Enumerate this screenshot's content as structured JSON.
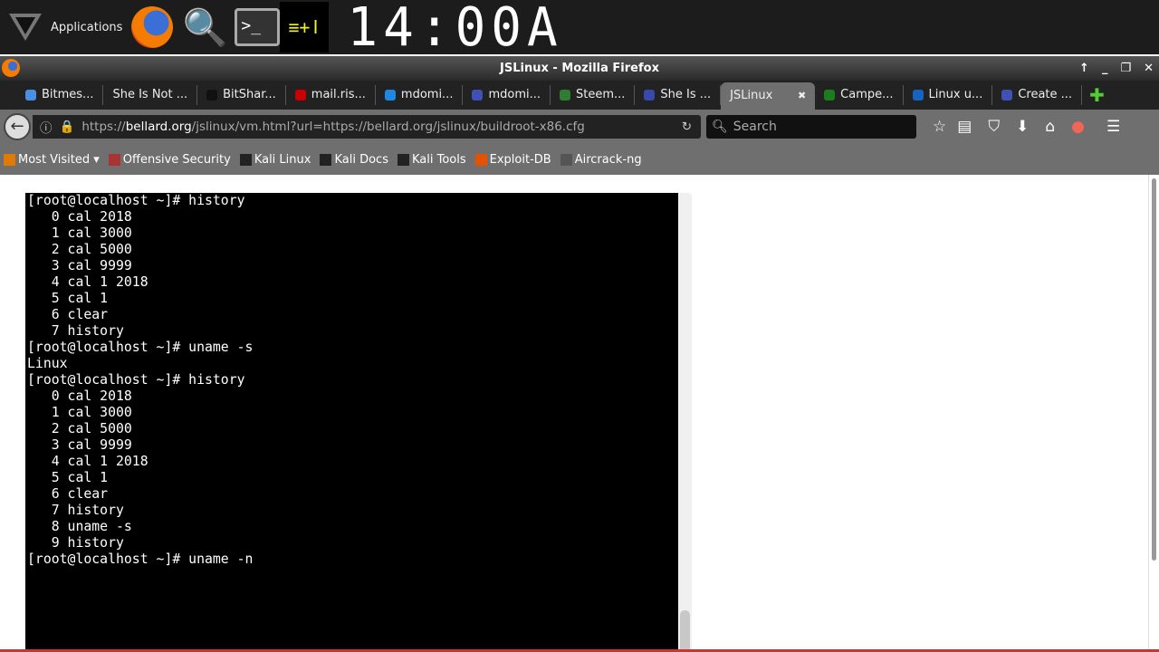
{
  "panel": {
    "applications_label": "Applications",
    "clock": "14:00A",
    "monitor_glyph": "≡+ǀ"
  },
  "window": {
    "title": "JSLinux - Mozilla Firefox",
    "controls": [
      "↑",
      "_",
      "❐",
      "✕"
    ]
  },
  "tabs": [
    {
      "label": "Bitmes...",
      "color": "#4a90e2"
    },
    {
      "label": "She Is Not ...",
      "color": ""
    },
    {
      "label": "BitShar...",
      "color": "#111"
    },
    {
      "label": "mail.ris...",
      "color": "#c00"
    },
    {
      "label": "mdomi...",
      "color": "#1e88e5"
    },
    {
      "label": "mdomi...",
      "color": "#3f51b5"
    },
    {
      "label": "Steem...",
      "color": "#2e7d32"
    },
    {
      "label": "She Is ...",
      "color": "#3949ab"
    },
    {
      "label": "JSLinux",
      "active": true,
      "close": "✖"
    },
    {
      "label": "Campe...",
      "color": "#1b7d1b"
    },
    {
      "label": "Linux u...",
      "color": "#1565c0"
    },
    {
      "label": "Create ...",
      "color": "#3f51b5"
    }
  ],
  "nav": {
    "url_prefix": "https://",
    "url_domain": "bellard.org",
    "url_rest": "/jslinux/vm.html?url=https://bellard.org/jslinux/buildroot-x86.cfg",
    "search_placeholder": "Search"
  },
  "bookmarks": [
    {
      "label": "Most Visited ▾",
      "color": "#e07b00"
    },
    {
      "label": "Offensive Security",
      "color": "#a33"
    },
    {
      "label": "Kali Linux",
      "color": "#222"
    },
    {
      "label": "Kali Docs",
      "color": "#222"
    },
    {
      "label": "Kali Tools",
      "color": "#222"
    },
    {
      "label": "Exploit-DB",
      "color": "#e65100"
    },
    {
      "label": "Aircrack-ng",
      "color": "#555"
    }
  ],
  "terminal": {
    "lines": [
      "[root@localhost ~]# history",
      "   0 cal 2018",
      "   1 cal 3000",
      "   2 cal 5000",
      "   3 cal 9999",
      "   4 cal 1 2018",
      "   5 cal 1",
      "   6 clear",
      "   7 history",
      "[root@localhost ~]# uname -s",
      "Linux",
      "[root@localhost ~]# history",
      "   0 cal 2018",
      "   1 cal 3000",
      "   2 cal 5000",
      "   3 cal 9999",
      "   4 cal 1 2018",
      "   5 cal 1",
      "   6 clear",
      "   7 history",
      "   8 uname -s",
      "   9 history",
      "[root@localhost ~]# uname -n"
    ]
  }
}
